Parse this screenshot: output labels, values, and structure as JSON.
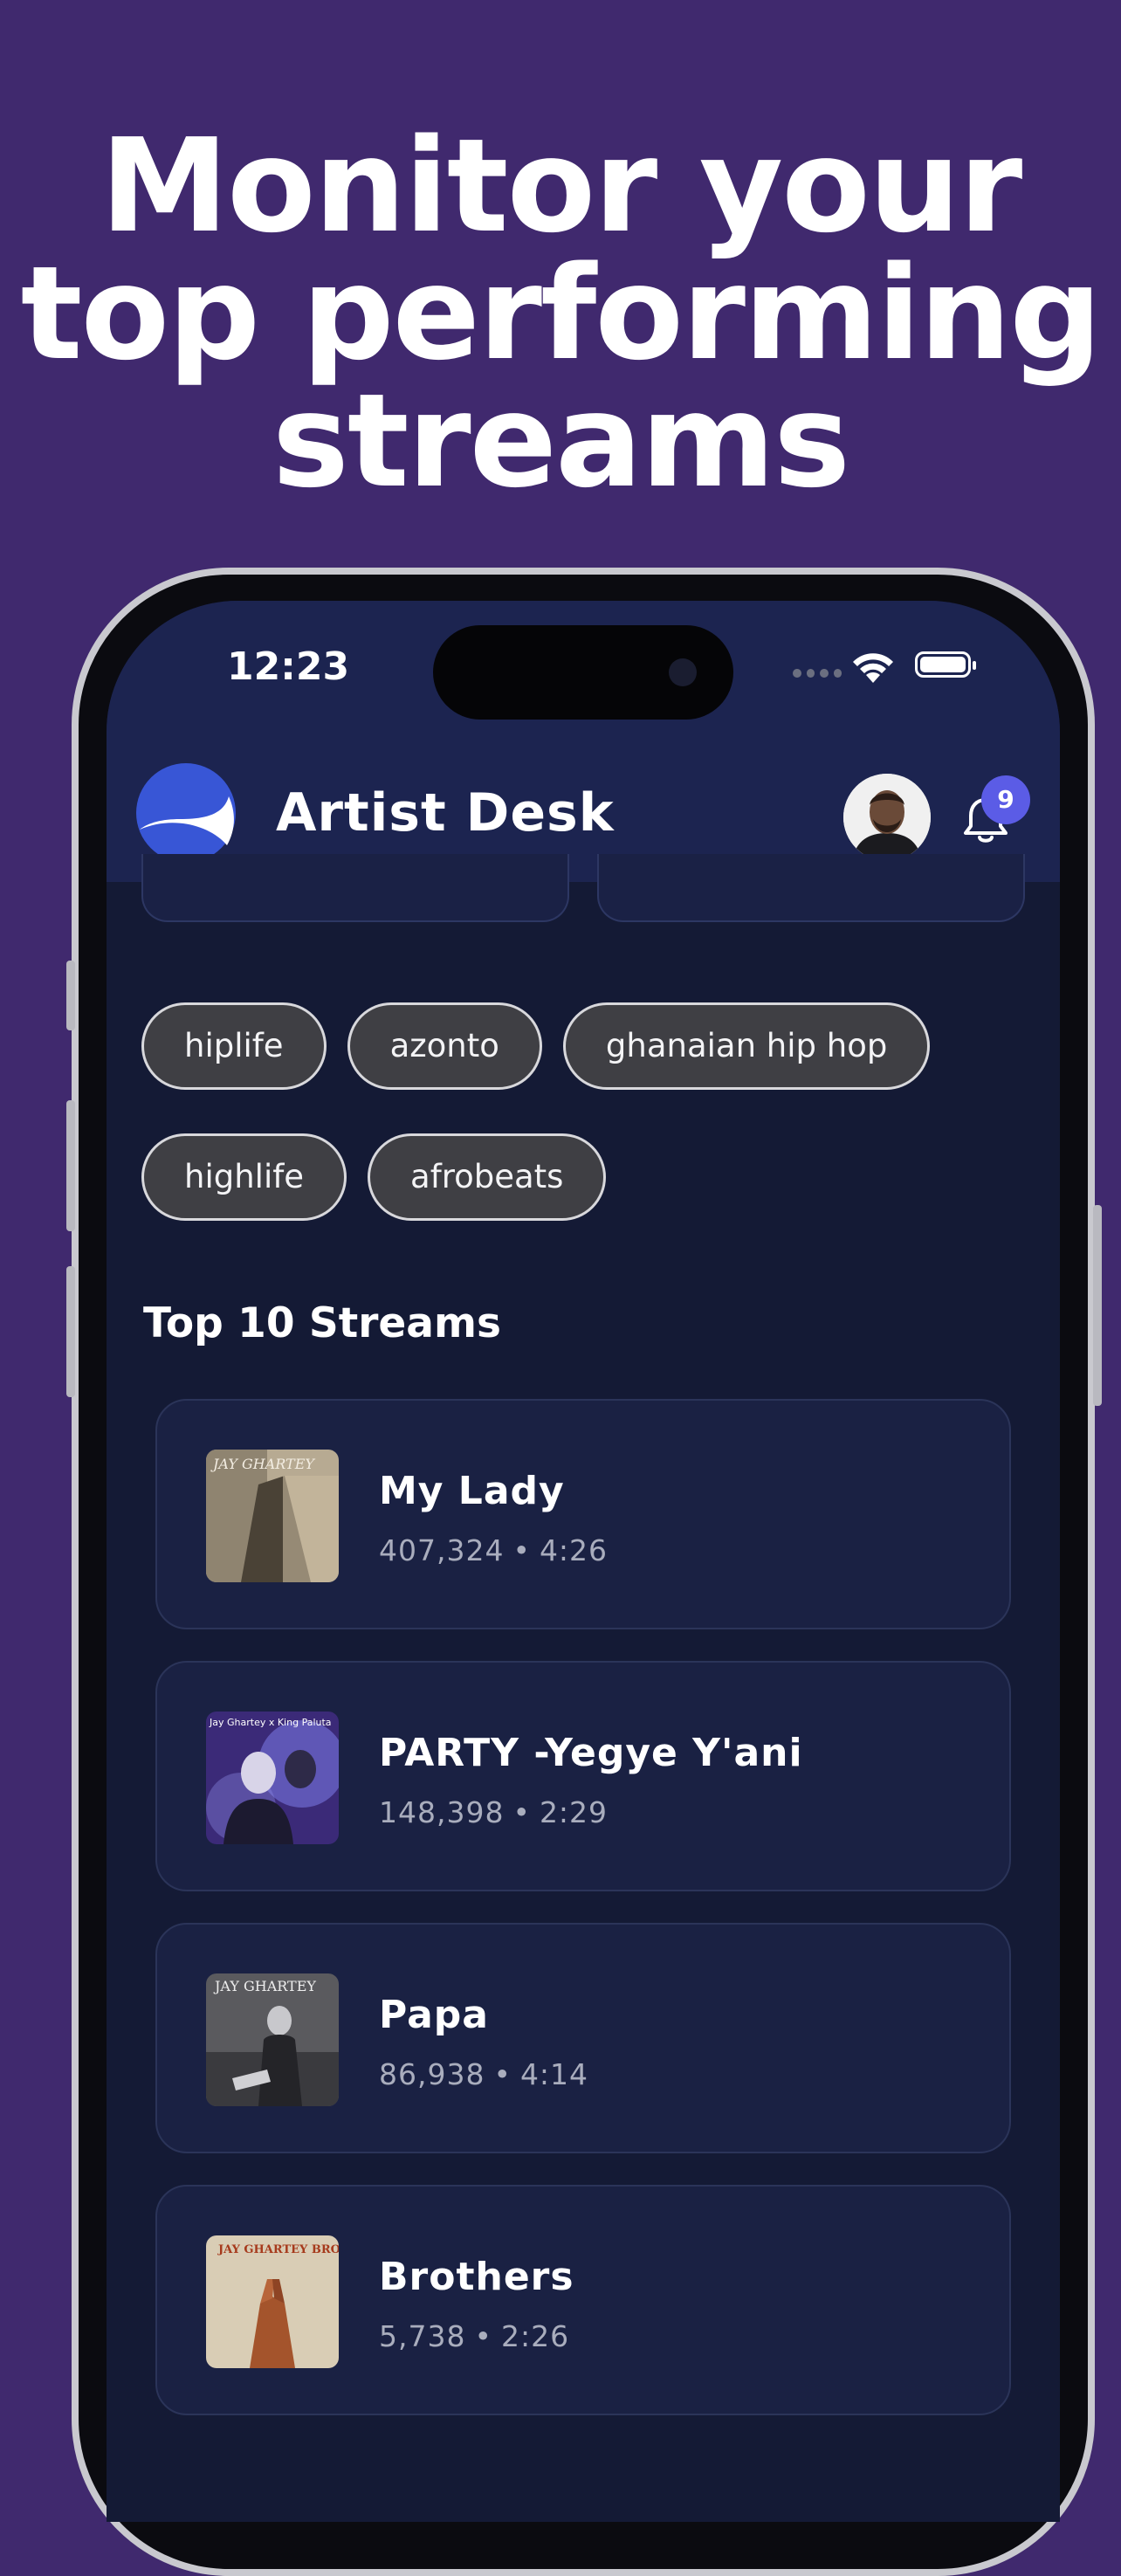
{
  "headline": {
    "line1": "Monitor your",
    "line2": "top performing",
    "line3": "streams"
  },
  "status_bar": {
    "time": "12:23",
    "icons": [
      "signal-dots-icon",
      "wifi-icon",
      "battery-icon"
    ]
  },
  "app_header": {
    "title": "Artist Desk",
    "logo_icon": "artist-desk-logo",
    "notification_count": "9",
    "colors": {
      "header_bg": "#1c2450",
      "badge": "#5b5ce6"
    }
  },
  "genres": {
    "row1": [
      "hiplife",
      "azonto",
      "ghanaian hip hop"
    ],
    "row2": [
      "highlife",
      "afrobeats"
    ]
  },
  "top_streams": {
    "title": "Top 10 Streams",
    "items": [
      {
        "title": "My Lady",
        "plays": "407,324",
        "duration": "4:26",
        "art_text": "JAY GHARTEY"
      },
      {
        "title": "PARTY -Yegye Y'ani",
        "plays": "148,398",
        "duration": "2:29",
        "art_text": "Jay Ghartey x King Paluta"
      },
      {
        "title": "Papa",
        "plays": "86,938",
        "duration": "4:14",
        "art_text": "JAY GHARTEY"
      },
      {
        "title": "Brothers",
        "plays": "5,738",
        "duration": "2:26",
        "art_text": "JAY GHARTEY BROTHERS"
      }
    ],
    "separator": "•"
  },
  "colors": {
    "page_bg": "#40296e",
    "screen_bg": "#141a35",
    "card_bg": "#1a2143",
    "chip_bg": "#3f3f44"
  }
}
